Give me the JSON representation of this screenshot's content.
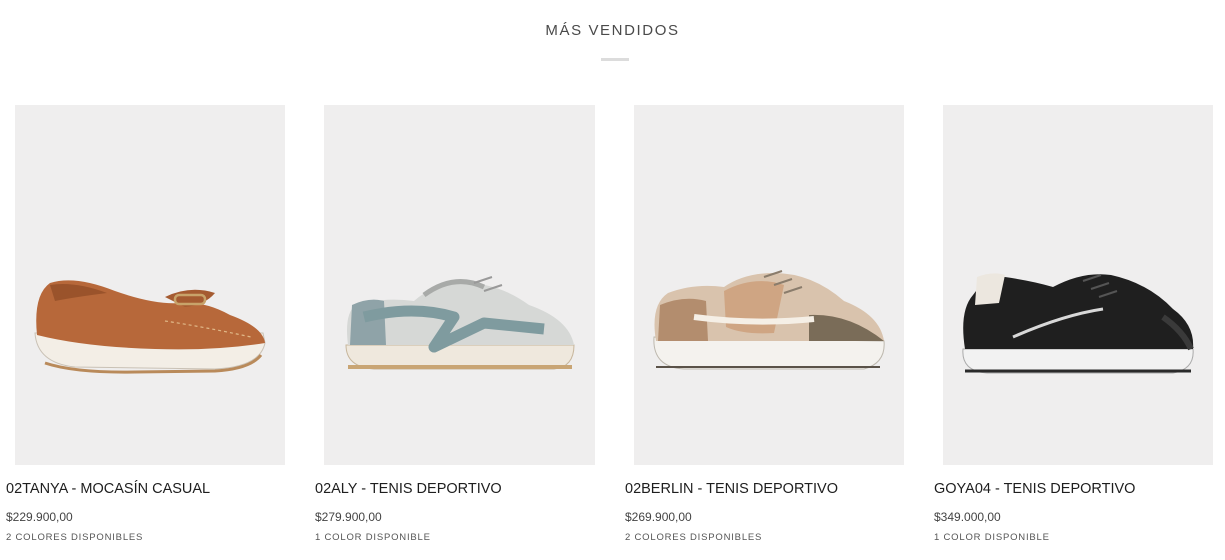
{
  "section": {
    "title": "MÁS VENDIDOS"
  },
  "products": [
    {
      "name": "02TANYA - MOCASÍN CASUAL",
      "price": "$229.900,00",
      "colors": "2 COLORES DISPONIBLES"
    },
    {
      "name": "02ALY - TENIS DEPORTIVO",
      "price": "$279.900,00",
      "colors": "1 COLOR DISPONIBLE"
    },
    {
      "name": "02BERLIN - TENIS DEPORTIVO",
      "price": "$269.900,00",
      "colors": "2 COLORES DISPONIBLES"
    },
    {
      "name": "GOYA04 - TENIS DEPORTIVO",
      "price": "$349.000,00",
      "colors": "1 COLOR DISPONIBLE"
    }
  ],
  "colors": {
    "image_bg": "#efeeee",
    "title_text": "#4a4a4a",
    "divider": "#dcdcdc"
  },
  "icons": [
    "loafer-shoe-image",
    "sneaker-shoe-image",
    "sneaker-shoe-image",
    "sneaker-shoe-image"
  ]
}
